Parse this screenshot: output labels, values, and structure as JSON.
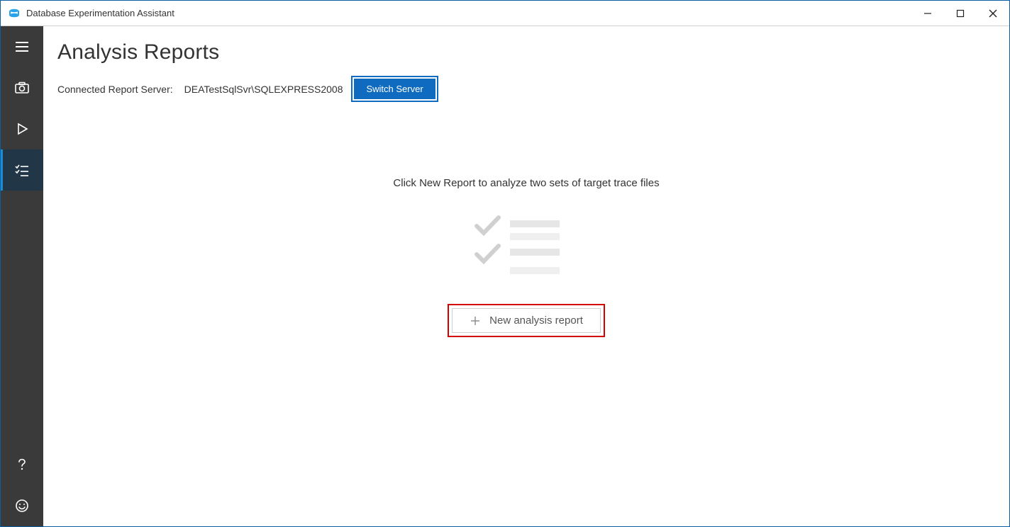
{
  "titlebar": {
    "app_title": "Database Experimentation Assistant"
  },
  "sidebar": {
    "items": [
      {
        "name": "menu",
        "icon": "hamburger-icon"
      },
      {
        "name": "capture",
        "icon": "camera-icon"
      },
      {
        "name": "replay",
        "icon": "play-icon"
      },
      {
        "name": "reports",
        "icon": "checklist-icon",
        "active": true
      },
      {
        "name": "help",
        "icon": "help-icon"
      },
      {
        "name": "feedback",
        "icon": "smiley-icon"
      }
    ]
  },
  "main": {
    "page_title": "Analysis Reports",
    "server_label": "Connected Report Server:",
    "server_value": "DEATestSqlSvr\\SQLEXPRESS2008",
    "switch_button_label": "Switch Server",
    "empty_hint": "Click New Report to analyze two sets of target trace files",
    "new_report_label": "New analysis report"
  },
  "colors": {
    "accent": "#0f6bbf",
    "sidebar_bg": "#3a3a3a",
    "sidebar_active_bg": "#213747",
    "sidebar_active_indicator": "#1e8bd1",
    "highlight_border": "#d30000"
  }
}
